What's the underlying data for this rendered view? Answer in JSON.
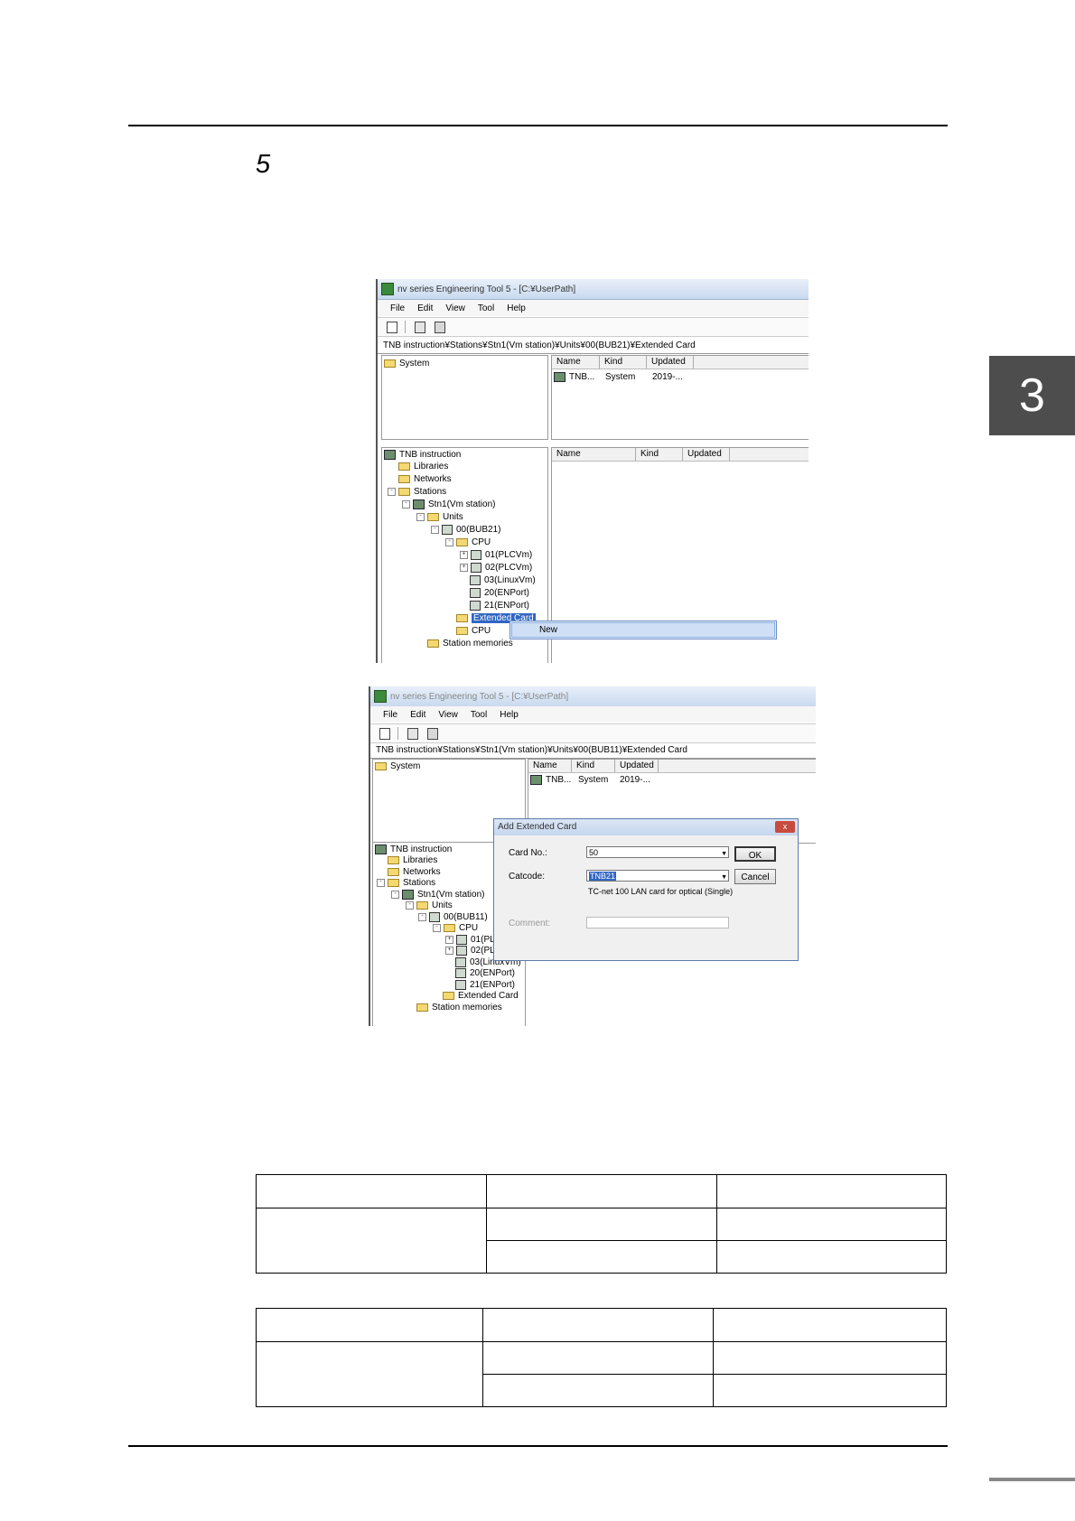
{
  "step": {
    "number": "5"
  },
  "chapter_tab": "3",
  "screenshot1": {
    "title": "nv series Engineering Tool 5 - [C:¥UserPath]",
    "menu": [
      "File",
      "Edit",
      "View",
      "Tool",
      "Help"
    ],
    "path": "TNB instruction¥Stations¥Stn1(Vm station)¥Units¥00(BUB21)¥Extended Card",
    "upper_tree": [
      "System"
    ],
    "upper_list": {
      "headers": [
        "Name",
        "Kind",
        "Updated"
      ],
      "rows": [
        [
          "TNB...",
          "System",
          "2019-..."
        ]
      ]
    },
    "lower_list": {
      "headers": [
        "Name",
        "Kind",
        "Updated"
      ]
    },
    "tree": [
      "TNB instruction",
      "Libraries",
      "Networks",
      "Stations",
      "Stn1(Vm station)",
      "Units",
      "00(BUB21)",
      "CPU",
      "01(PLCVm)",
      "02(PLCVm)",
      "03(LinuxVm)",
      "20(ENPort)",
      "21(ENPort)",
      "Extended Card",
      "CPU",
      "Station memories"
    ],
    "context_menu": [
      "New"
    ]
  },
  "screenshot2": {
    "title": "nv series Engineering Tool 5 - [C:¥UserPath]",
    "menu": [
      "File",
      "Edit",
      "View",
      "Tool",
      "Help"
    ],
    "path": "TNB instruction¥Stations¥Stn1(Vm station)¥Units¥00(BUB11)¥Extended Card",
    "upper_tree": [
      "System"
    ],
    "upper_list": {
      "headers": [
        "Name",
        "Kind",
        "Updated"
      ],
      "rows": [
        [
          "TNB...",
          "System",
          "2019-..."
        ]
      ]
    },
    "tree": [
      "TNB instruction",
      "Libraries",
      "Networks",
      "Stations",
      "Stn1(Vm station)",
      "Units",
      "00(BUB11)",
      "CPU",
      "01(PL",
      "02(PL",
      "03(LinuxVm)",
      "20(ENPort)",
      "21(ENPort)",
      "Extended Card",
      "Station memories"
    ],
    "dialog": {
      "title": "Add Extended Card",
      "close": "x",
      "card_no_label": "Card No.:",
      "card_no_value": "50",
      "catcode_label": "Catcode:",
      "catcode_value": "TNB21",
      "catcode_desc": "TC-net 100 LAN card for optical (Single)",
      "comment_label": "Comment:",
      "comment_value": "",
      "ok": "OK",
      "cancel": "Cancel"
    }
  }
}
